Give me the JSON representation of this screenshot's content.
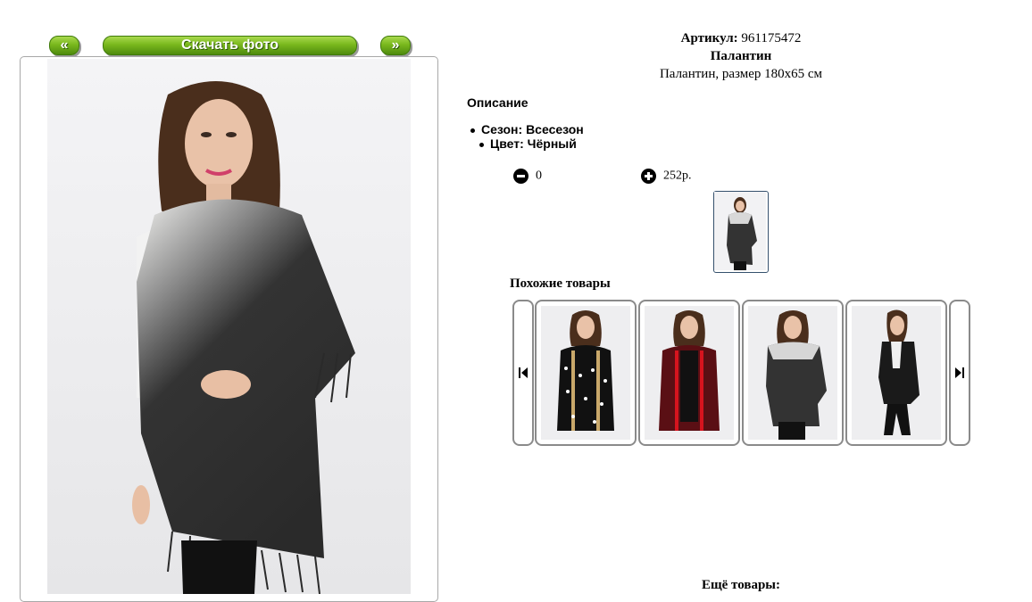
{
  "nav": {
    "prev_label": "«",
    "download_label": "Скачать фото",
    "next_label": "»"
  },
  "product": {
    "article_label": "Артикул:",
    "article_value": "961175472",
    "title": "Палантин",
    "description": "Палантин, размер 180х65 см"
  },
  "description_section": {
    "heading": "Описание",
    "items": [
      "Сезон: Всесезон",
      "Цвет: Чёрный"
    ]
  },
  "purchase": {
    "quantity": "0",
    "price": "252р."
  },
  "similar": {
    "heading": "Похожие товары",
    "items": [
      {
        "name": "black-polka-dot-cardigan"
      },
      {
        "name": "red-polka-dot-cardigan"
      },
      {
        "name": "ombre-stole"
      },
      {
        "name": "black-long-cardigan"
      }
    ]
  },
  "more": {
    "heading": "Ещё товары:"
  },
  "colors": {
    "button_green": "#79b81d",
    "frame_border": "#a8a8a8",
    "thumb_border": "#35506c"
  }
}
